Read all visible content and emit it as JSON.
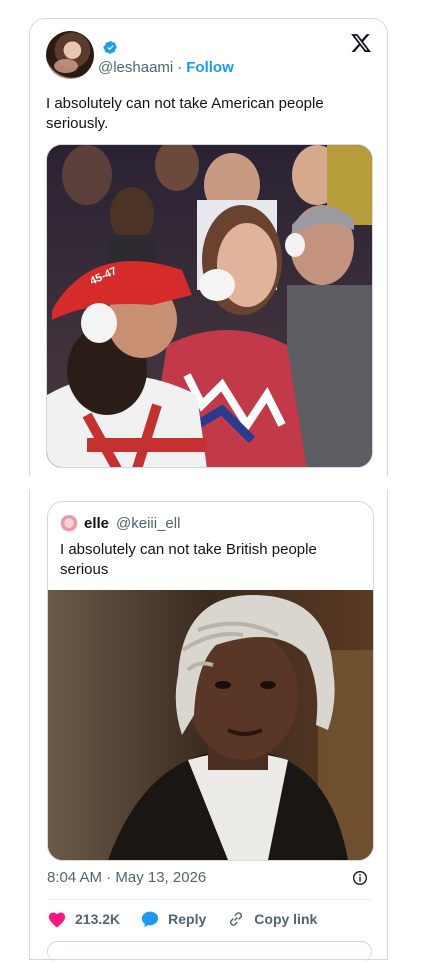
{
  "tweet": {
    "handle": "@leshaami",
    "separator": "·",
    "follow_label": "Follow",
    "text": "I absolutely can not take American people seriously.",
    "media_description": "image"
  },
  "quote": {
    "name": "elle",
    "handle": "@keiii_ell",
    "text": "I absolutely can not take British people serious"
  },
  "footer": {
    "timestamp": "8:04 AM · May 13, 2026",
    "likes": "213.2K",
    "reply_label": "Reply",
    "copy_label": "Copy link"
  },
  "icons": {
    "verified": "verified-badge-icon",
    "x_logo": "x-logo-icon",
    "info": "info-icon",
    "heart": "heart-icon",
    "reply": "reply-bubble-icon",
    "link": "link-icon"
  },
  "colors": {
    "accent": "#1d9bf0",
    "like": "#f91880",
    "muted": "#536471",
    "border": "#cfd9de"
  }
}
